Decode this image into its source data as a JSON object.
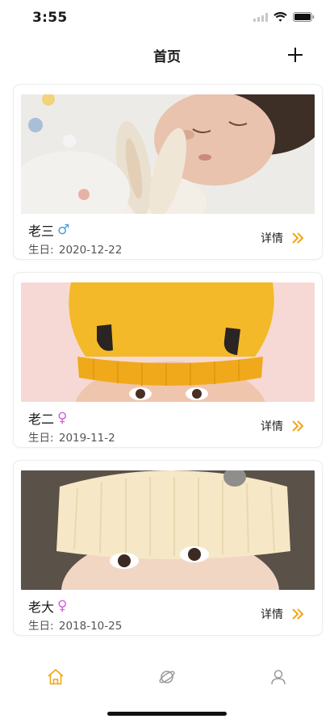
{
  "status": {
    "time": "3:55"
  },
  "header": {
    "title": "首页"
  },
  "children": [
    {
      "name": "老三",
      "gender_symbol": "♂",
      "gender_color": "#4a9fd8",
      "birth_label": "生日:",
      "birth_date": "2020-12-22",
      "details_label": "详情"
    },
    {
      "name": "老二",
      "gender_symbol": "♀",
      "gender_color": "#d35fe0",
      "birth_label": "生日:",
      "birth_date": "2019-11-2",
      "details_label": "详情"
    },
    {
      "name": "老大",
      "gender_symbol": "♀",
      "gender_color": "#d35fe0",
      "birth_label": "生日:",
      "birth_date": "2018-10-25",
      "details_label": "详情"
    }
  ],
  "tabs": [
    {
      "icon": "home-icon",
      "active": true
    },
    {
      "icon": "planet-icon",
      "active": false
    },
    {
      "icon": "user-icon",
      "active": false
    }
  ],
  "colors": {
    "accent": "#f2a413",
    "inactive_tab": "#9a9a9a"
  }
}
